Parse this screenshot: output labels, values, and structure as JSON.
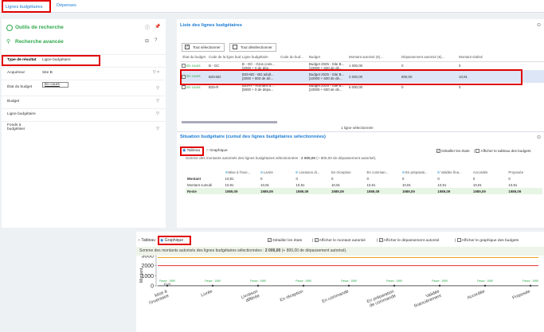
{
  "tabs": {
    "lignes": "Lignes budgétaires",
    "depenses": "Dépenses"
  },
  "left": {
    "outils": "Outils de recherche",
    "recherche": "Recherche avancée",
    "fields": [
      {
        "label": "Type de résultat",
        "value": "Ligne budgétaire"
      },
      {
        "label": "Acquéreur",
        "value": "Site B"
      },
      {
        "label": "État du budget",
        "value": "En cours"
      },
      {
        "label": "Budget",
        "value": ""
      },
      {
        "label": "Ligne budgétaire",
        "value": ""
      },
      {
        "label": "Fonds à budgétiser",
        "value": ""
      }
    ]
  },
  "liste": {
    "title": "Liste des lignes budgétaires",
    "btn_select": "Tout sélectionner",
    "btn_deselect": "Tout désélectionner",
    "headers": [
      "État du budget",
      "Code de la ligne budgétai...",
      "Ligne budgétaire",
      "Code du bud...",
      "Budget",
      "Montant autorisé (€)...",
      "Dépassement autorisé (€)...",
      "Montant réalisé"
    ],
    "rows": [
      {
        "etat": "En cours",
        "code": "B - GC",
        "ligne": "B - GC - Gros cons...",
        "ligne2": "[2000 + 0 de dép...",
        "codebud": "",
        "budget": "Budget 2025 - Site B...",
        "budget2": "[10000 + 500 de dé...",
        "montant": "1 000,00",
        "depassement": "0",
        "realise": "0"
      },
      {
        "etat": "En cours",
        "code": "B25-BD",
        "ligne": "B25-BD - BD adult...",
        "ligne2": "[2000 + 800 de dé...",
        "codebud": "",
        "budget": "Budget 2025 - Site B...",
        "budget2": "[10000 + 500 de dé...",
        "montant": "2 000,00",
        "depassement": "800,00",
        "realise": "10,91"
      },
      {
        "etat": "En cours",
        "code": "B25-R",
        "ligne": "B25-R - Romans a...",
        "ligne2": "[5000 + 0 de dépa...",
        "codebud": "",
        "budget": "Budget 2025 - Site B...",
        "budget2": "[10000 + 500 de dé...",
        "montant": "5 000,00",
        "depassement": "0",
        "realise": "0"
      }
    ],
    "footer": "1 ligne sélectionnée"
  },
  "situation": {
    "title": "Situation budgétaire (cumul des lignes budgétaires sélectionnées)",
    "tableau": "Tableau",
    "graphique": "Graphique",
    "detailler": "Détailler les états",
    "afficher_tableau": "Afficher le tableau des budgets",
    "somme_prefix": "Somme des montants autorisés des lignes budgétaires sélectionnées : ",
    "somme_value": "2 000,00",
    "somme_suffix": " (+ 800,00 de dépassement autorisé).",
    "cols": [
      "Mise à l'inve...",
      "Livrée",
      "Livraison di...",
      "En réception",
      "En comman...",
      "En préparati...",
      "Validée fina...",
      "Accordée",
      "Proposée"
    ],
    "rows": [
      {
        "label": "Montant",
        "values": [
          "10,91",
          "0",
          "0",
          "0",
          "0",
          "0",
          "0",
          "0",
          "0"
        ]
      },
      {
        "label": "Montant cumulé",
        "values": [
          "10,91",
          "10,91",
          "10,91",
          "10,91",
          "10,91",
          "10,91",
          "10,91",
          "10,91",
          "10,91"
        ]
      },
      {
        "label": "Reste",
        "values": [
          "1989,09",
          "1989,09",
          "1989,09",
          "1989,09",
          "1989,09",
          "1989,09",
          "1989,09",
          "1989,09",
          "1989,09"
        ]
      }
    ]
  },
  "bottom": {
    "tableau": "Tableau",
    "graphique": "Graphique",
    "detailler": "Détailler les états",
    "afficher_montant": "Afficher le montant autorisé",
    "afficher_depassement": "Afficher le dépassement autorisé",
    "afficher_graph": "Afficher le graphique des budgets",
    "somme_prefix": "Somme des montants autorisés des lignes budgétaires sélectionnées : ",
    "somme_value": "2 000,00",
    "somme_suffix": " (+ 800,00 de dépassement autorisé)."
  },
  "chart_data": {
    "type": "line",
    "ylabel": "Montant",
    "ylim": [
      0,
      3000
    ],
    "yticks": [
      "3000",
      "2000",
      "1000",
      "0"
    ],
    "categories": [
      "Mise à l'inventaire",
      "Livrée",
      "Livraison différée",
      "En réception",
      "En commande",
      "En préparation de commande",
      "Validée financièrement",
      "Accordée",
      "Proposée"
    ],
    "series": [
      {
        "values": [
          2800,
          2800,
          2800,
          2800,
          2800,
          2800,
          2800,
          2800,
          2800
        ],
        "color": "#f0a020"
      },
      {
        "values": [
          2000,
          2000,
          2000,
          2000,
          2000,
          2000,
          2000,
          2000,
          2000
        ],
        "color": "#e03030"
      },
      {
        "values": [
          10.91,
          10.91,
          10.91,
          10.91,
          10.91,
          10.91,
          10.91,
          10.91,
          10.91
        ],
        "color": "#333333"
      }
    ],
    "point_labels": [
      "Passe : 1989",
      "Passe : 1989",
      "Passe : 1989",
      "Passe : 1989",
      "Passe : 1989",
      "Passe : 1989",
      "Passe : 1989",
      "Passe : 1989",
      "Passe : 1989"
    ],
    "first_value_label": "10,91"
  }
}
